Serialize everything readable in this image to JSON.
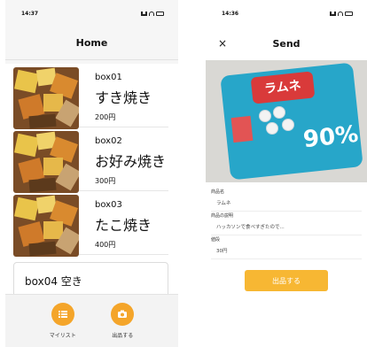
{
  "left": {
    "status_time": "14:37",
    "title": "Home",
    "boxes": [
      {
        "code": "box01",
        "name": "すき焼き",
        "price": "200円"
      },
      {
        "code": "box02",
        "name": "お好み焼き",
        "price": "300円"
      },
      {
        "code": "box03",
        "name": "たこ焼き",
        "price": "400円"
      }
    ],
    "empty_box": "box04 空き",
    "tabs": [
      {
        "label": "マイリスト",
        "icon": "list-icon"
      },
      {
        "label": "出品する",
        "icon": "camera-icon"
      }
    ]
  },
  "right": {
    "status_time": "14:36",
    "close_label": "×",
    "title": "Send",
    "photo": {
      "brand": "ラムネ",
      "percent": "90%"
    },
    "form": {
      "name_label": "商品名",
      "name_value": "ラムネ",
      "desc_label": "商品の説明",
      "desc_value": "ハッカソンで食べすぎたので...",
      "price_label": "値段",
      "price_value": "30円"
    },
    "submit_label": "出品する"
  },
  "colors": {
    "accent": "#f4a52a",
    "submit": "#f7b733",
    "bag": "#27a6c9"
  }
}
